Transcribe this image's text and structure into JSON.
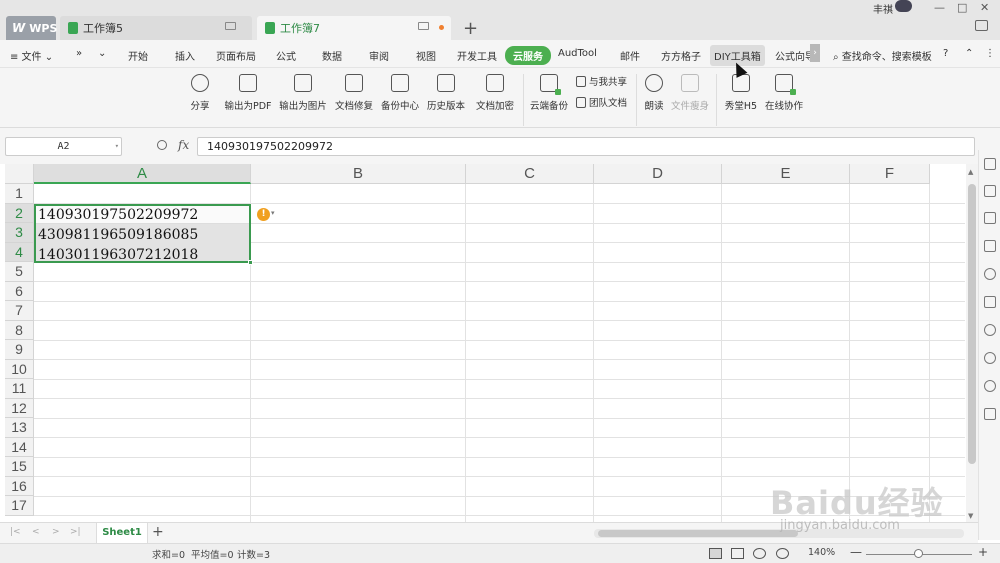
{
  "titlebar": {
    "tabs": [
      {
        "label": "WPS",
        "logo": "W"
      },
      {
        "label": "工作簿5"
      },
      {
        "label": "工作簿7"
      }
    ],
    "new_tab": "+",
    "user": "丰祺",
    "window_buttons": [
      "—",
      "□",
      "✕"
    ]
  },
  "menu": {
    "file": "≡ 文件 ⌄",
    "nav_more": "»",
    "nav_dropdown": "⌄",
    "items": [
      "开始",
      "插入",
      "页面布局",
      "公式",
      "数据",
      "审阅",
      "视图",
      "开发工具",
      "云服务",
      "AudTool",
      "邮件",
      "方方格子",
      "DIY工具箱",
      "公式向导"
    ],
    "more": "›",
    "search": "查找命令、搜索模板",
    "help": "?",
    "collapse": "⌃",
    "overflow": "⋮"
  },
  "ribbon": {
    "buttons": [
      "分享",
      "输出为PDF",
      "输出为图片",
      "文档修复",
      "备份中心",
      "历史版本",
      "文档加密",
      "云端备份",
      "朗读",
      "文件瘦身",
      "秀堂H5",
      "在线协作"
    ],
    "small": [
      "与我共享",
      "团队文档"
    ]
  },
  "formula_bar": {
    "name_box": "A2",
    "fx": "fx",
    "value": "140930197502209972"
  },
  "grid": {
    "columns": [
      "A",
      "B",
      "C",
      "D",
      "E",
      "F"
    ],
    "rows": [
      "1",
      "2",
      "3",
      "4",
      "5",
      "6",
      "7",
      "8",
      "9",
      "10",
      "11",
      "12",
      "13",
      "14",
      "15",
      "16",
      "17"
    ],
    "cells": [
      {
        "ref": "A2",
        "value": "140930197502209972"
      },
      {
        "ref": "A3",
        "value": "430981196509186085"
      },
      {
        "ref": "A4",
        "value": "140301196307212018"
      }
    ],
    "warning": "!"
  },
  "sheets": {
    "tabs": [
      "Sheet1"
    ],
    "add": "+",
    "nav": [
      "|<",
      "<",
      ">",
      ">|"
    ]
  },
  "status": {
    "sum": "求和=0",
    "average": "平均值=0",
    "count": "计数=3",
    "zoom": "140%",
    "zoom_minus": "—",
    "zoom_plus": "+",
    "zoom_value": 0.5
  },
  "watermark": {
    "main": "Baidu经验",
    "sub": "jingyan.baidu.com"
  }
}
